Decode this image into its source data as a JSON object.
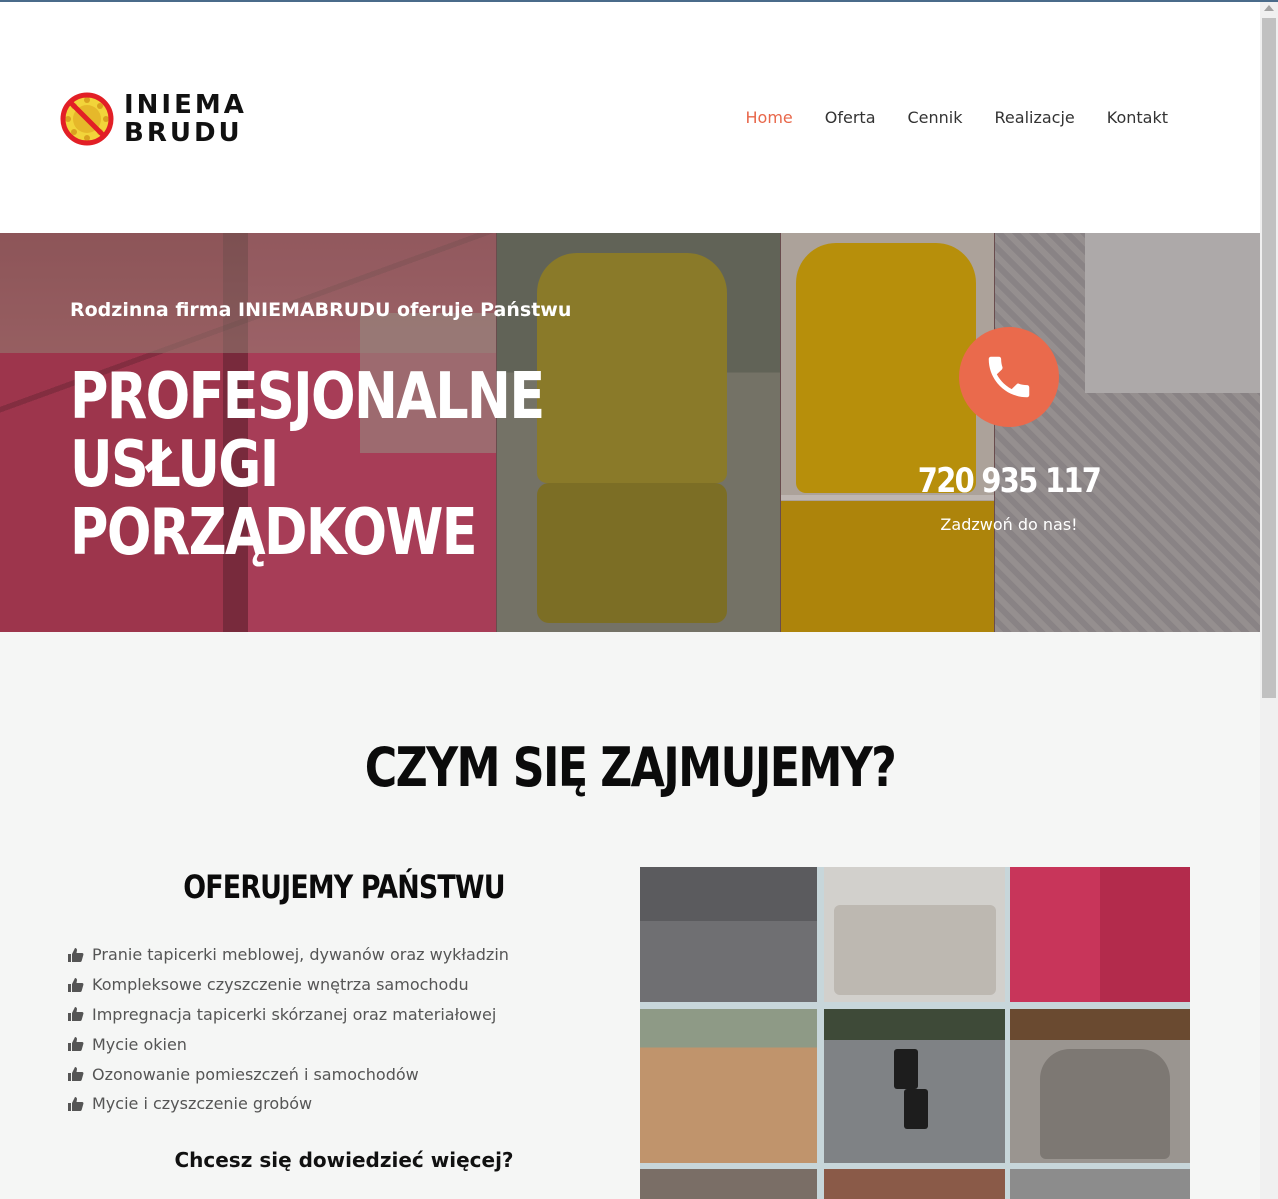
{
  "brand": {
    "logo_line1": "INIEMA",
    "logo_line2": "BRUDU",
    "accent_color": "#e8674a"
  },
  "nav": {
    "items": [
      {
        "label": "Home",
        "active": true
      },
      {
        "label": "Oferta",
        "active": false
      },
      {
        "label": "Cennik",
        "active": false
      },
      {
        "label": "Realizacje",
        "active": false
      },
      {
        "label": "Kontakt",
        "active": false
      }
    ]
  },
  "hero": {
    "subtitle": "Rodzinna firma INIEMABRUDU oferuje Państwu",
    "title_line1": "PROFESJONALNE USŁUGI",
    "title_line2": "PORZĄDKOWE",
    "phone_icon": "phone-icon",
    "phone_number": "720 935 117",
    "call_caption": "Zadzwoń do nas!",
    "call_button_color": "#ea6a4c"
  },
  "services": {
    "section_title": "CZYM SIĘ ZAJMUJEMY?",
    "offer_title": "OFERUJEMY PAŃSTWU",
    "bullet_icon": "thumbs-up-icon",
    "items": [
      "Pranie tapicerki meblowej, dywanów oraz wykładzin",
      "Kompleksowe czyszczenie wnętrza samochodu",
      "Impregnacja tapicerki skórzanej oraz materiałowej",
      "Mycie okien",
      "Ozonowanie pomieszczeń i samochodów",
      "Mycie i czyszczenie grobów"
    ],
    "cta": "Chcesz się dowiedzieć więcej?"
  }
}
